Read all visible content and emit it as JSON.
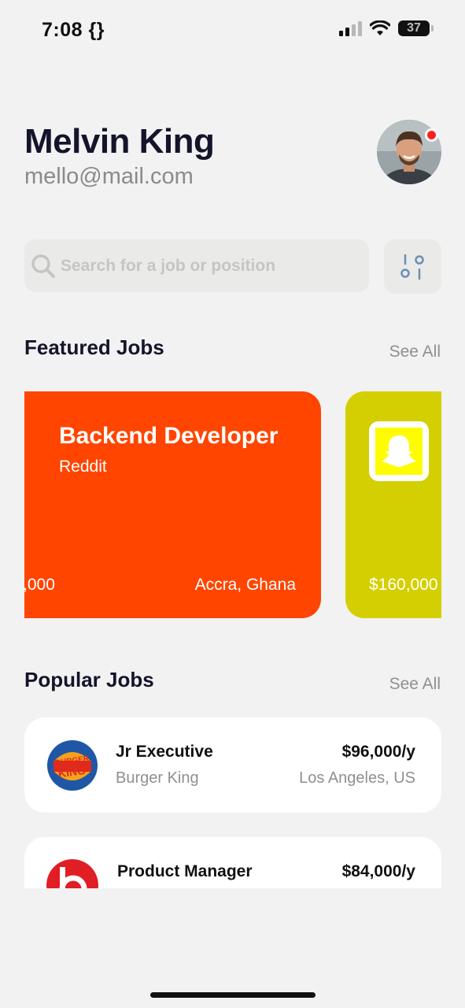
{
  "status_bar": {
    "time": "7:08 {}",
    "battery": "37",
    "battery_level": 0.37
  },
  "profile": {
    "name": "Melvin King",
    "email": "mello@mail.com",
    "avatar_icon": "person-avatar",
    "has_notification": true
  },
  "search": {
    "placeholder": "Search for a job or position",
    "value": ""
  },
  "featured": {
    "title": "Featured Jobs",
    "see_all": "See All",
    "cards": [
      {
        "title": "Backend Developer",
        "company": "Reddit",
        "salary": ",000",
        "location": "Accra, Ghana",
        "color": "#ff4500",
        "logo_icon": "reddit-logo"
      },
      {
        "title": "",
        "company": "",
        "salary": "$160,000",
        "location": "",
        "color": "#d4cf00",
        "logo_icon": "snapchat-logo"
      }
    ]
  },
  "popular": {
    "title": "Popular Jobs",
    "see_all": "See All",
    "items": [
      {
        "title": "Jr Executive",
        "company": "Burger King",
        "salary": "$96,000/y",
        "location": "Los Angeles, US",
        "logo_icon": "burger-king-logo"
      },
      {
        "title": "Product Manager",
        "company": "",
        "salary": "$84,000/y",
        "location": "",
        "logo_icon": "beats-logo"
      }
    ]
  },
  "colors": {
    "background": "#f2f2f2",
    "reddit_orange": "#ff4500",
    "snapchat_yellow": "#d4cf00",
    "notification_red": "#ff1f1f"
  }
}
